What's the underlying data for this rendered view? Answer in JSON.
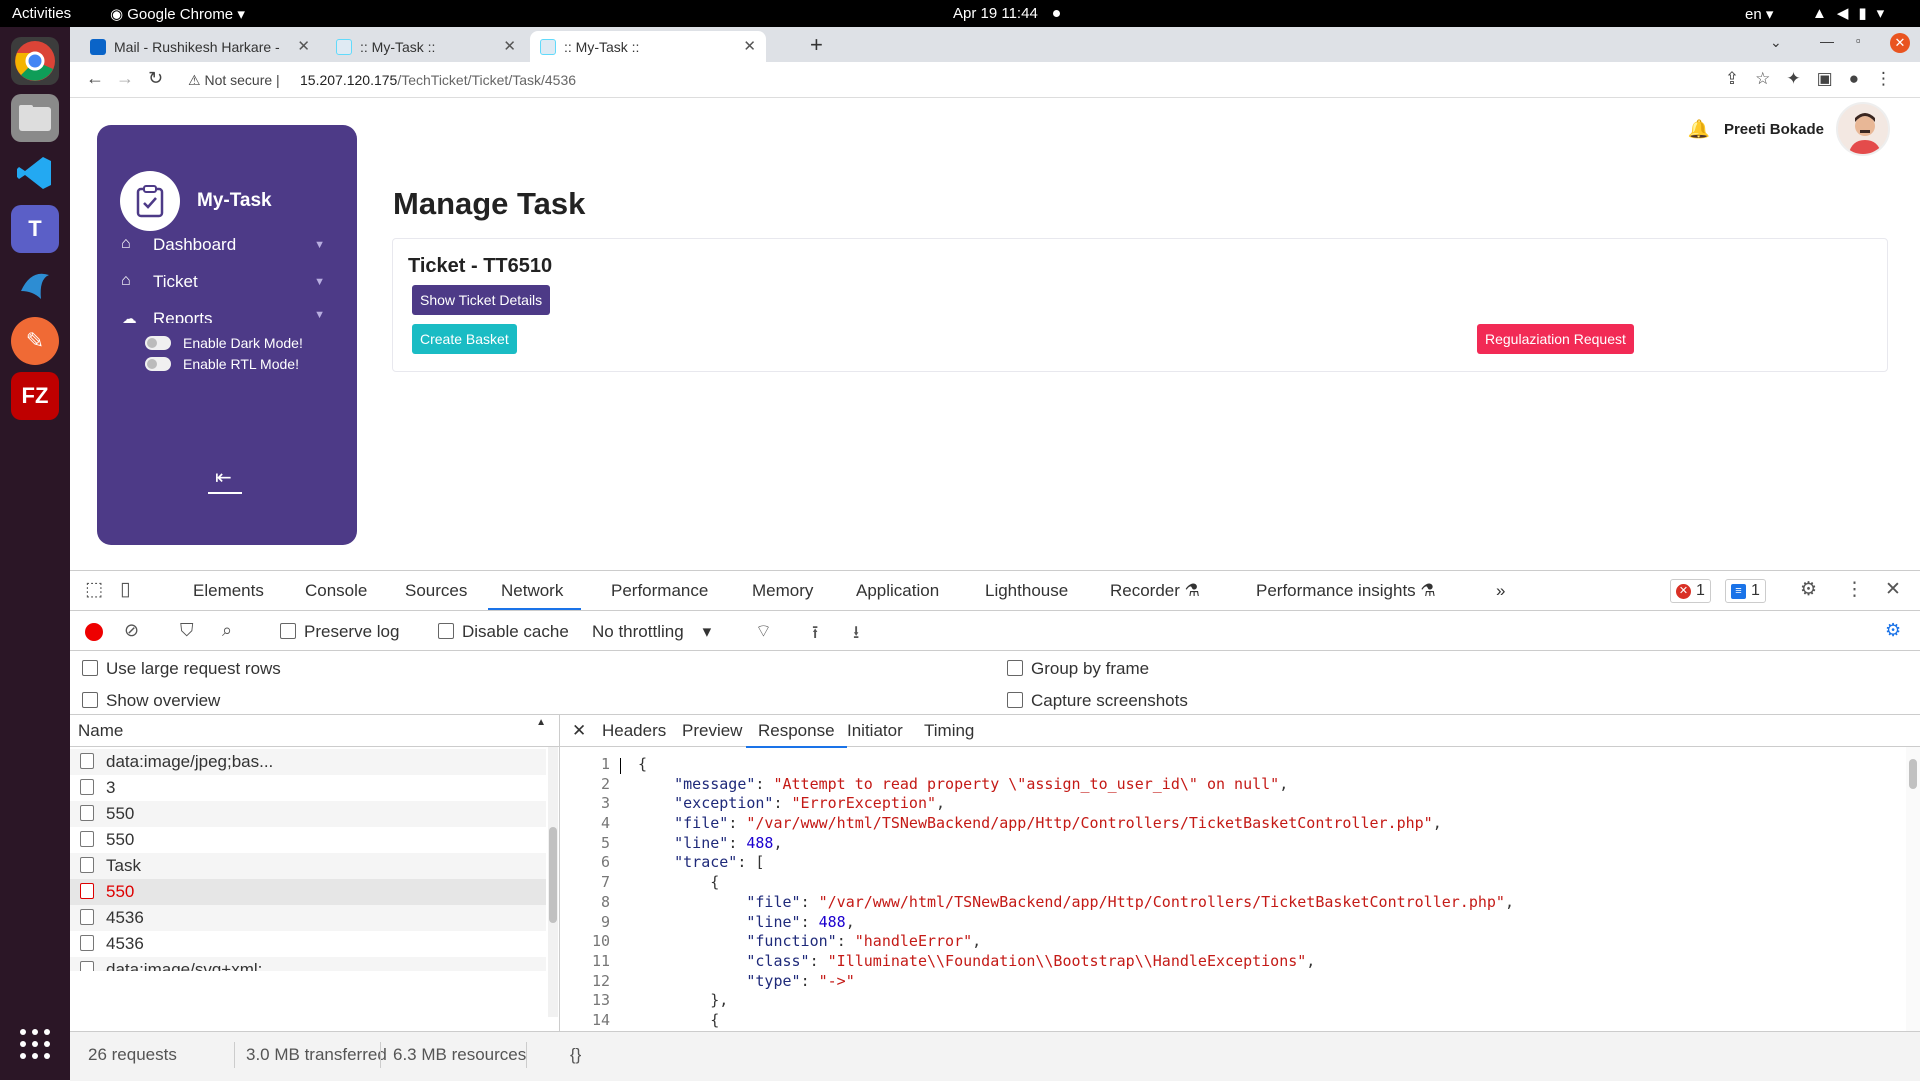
{
  "os": {
    "activities": "Activities",
    "app_name": "Google Chrome",
    "clock": "Apr 19  11:44",
    "lang": "en"
  },
  "browser": {
    "tabs": [
      {
        "label": "Mail - Rushikesh Harkare -",
        "icon": "outlook-icon"
      },
      {
        "label": ":: My-Task ::",
        "icon": "react-icon"
      },
      {
        "label": ":: My-Task ::",
        "icon": "react-icon"
      }
    ],
    "not_secure": "Not secure",
    "url_host": "15.207.120.175",
    "url_path": "/TechTicket/Ticket/Task/4536"
  },
  "app": {
    "brand": "My-Task",
    "menu": [
      {
        "label": "Dashboard",
        "icon": "home-icon"
      },
      {
        "label": "Ticket",
        "icon": "home-icon"
      },
      {
        "label": "Reports",
        "icon": "cloud-icon"
      }
    ],
    "toggles": [
      "Enable Dark Mode!",
      "Enable RTL Mode!"
    ],
    "user_name": "Preeti Bokade",
    "page_title": "Manage Task",
    "ticket_title": "Ticket - TT6510",
    "show_details_btn": "Show Ticket Details",
    "create_basket_btn": "Create Basket",
    "regularization_btn": "Regulaziation Request"
  },
  "devtools": {
    "tabs": [
      "Elements",
      "Console",
      "Sources",
      "Network",
      "Performance",
      "Memory",
      "Application",
      "Lighthouse",
      "Recorder",
      "Performance insights"
    ],
    "active_tab": "Network",
    "error_count": "1",
    "message_count": "1",
    "preserve_log": "Preserve log",
    "disable_cache": "Disable cache",
    "throttling": "No throttling",
    "options": {
      "large_rows": "Use large request rows",
      "show_overview": "Show overview",
      "group_by_frame": "Group by frame",
      "capture_screenshots": "Capture screenshots"
    },
    "name_header": "Name",
    "requests": [
      {
        "name": "data:image/jpeg;bas...",
        "status": "normal"
      },
      {
        "name": "3",
        "status": "normal"
      },
      {
        "name": "550",
        "status": "normal"
      },
      {
        "name": "550",
        "status": "normal"
      },
      {
        "name": "Task",
        "status": "normal"
      },
      {
        "name": "550",
        "status": "error"
      },
      {
        "name": "4536",
        "status": "normal"
      },
      {
        "name": "4536",
        "status": "normal"
      },
      {
        "name": "data:image/svg+xml;...",
        "status": "normal"
      }
    ],
    "detail_tabs": [
      "Headers",
      "Preview",
      "Response",
      "Initiator",
      "Timing"
    ],
    "active_detail_tab": "Response",
    "response_lines": [
      {
        "n": "1",
        "indent": "",
        "parts": [
          [
            "p",
            "{"
          ]
        ]
      },
      {
        "n": "2",
        "indent": "    ",
        "parts": [
          [
            "k",
            "\"message\""
          ],
          [
            "p",
            ": "
          ],
          [
            "s",
            "\"Attempt to read property \\\"assign_to_user_id\\\" on null\""
          ],
          [
            "p",
            ","
          ]
        ]
      },
      {
        "n": "3",
        "indent": "    ",
        "parts": [
          [
            "k",
            "\"exception\""
          ],
          [
            "p",
            ": "
          ],
          [
            "s",
            "\"ErrorException\""
          ],
          [
            "p",
            ","
          ]
        ]
      },
      {
        "n": "4",
        "indent": "    ",
        "parts": [
          [
            "k",
            "\"file\""
          ],
          [
            "p",
            ": "
          ],
          [
            "s",
            "\"/var/www/html/TSNewBackend/app/Http/Controllers/TicketBasketController.php\""
          ],
          [
            "p",
            ","
          ]
        ]
      },
      {
        "n": "5",
        "indent": "    ",
        "parts": [
          [
            "k",
            "\"line\""
          ],
          [
            "p",
            ": "
          ],
          [
            "n",
            "488"
          ],
          [
            "p",
            ","
          ]
        ]
      },
      {
        "n": "6",
        "indent": "    ",
        "parts": [
          [
            "k",
            "\"trace\""
          ],
          [
            "p",
            ": ["
          ]
        ]
      },
      {
        "n": "7",
        "indent": "        ",
        "parts": [
          [
            "p",
            "{"
          ]
        ]
      },
      {
        "n": "8",
        "indent": "            ",
        "parts": [
          [
            "k",
            "\"file\""
          ],
          [
            "p",
            ": "
          ],
          [
            "s",
            "\"/var/www/html/TSNewBackend/app/Http/Controllers/TicketBasketController.php\""
          ],
          [
            "p",
            ","
          ]
        ]
      },
      {
        "n": "9",
        "indent": "            ",
        "parts": [
          [
            "k",
            "\"line\""
          ],
          [
            "p",
            ": "
          ],
          [
            "n",
            "488"
          ],
          [
            "p",
            ","
          ]
        ]
      },
      {
        "n": "10",
        "indent": "            ",
        "parts": [
          [
            "k",
            "\"function\""
          ],
          [
            "p",
            ": "
          ],
          [
            "s",
            "\"handleError\""
          ],
          [
            "p",
            ","
          ]
        ]
      },
      {
        "n": "11",
        "indent": "            ",
        "parts": [
          [
            "k",
            "\"class\""
          ],
          [
            "p",
            ": "
          ],
          [
            "s",
            "\"Illuminate\\\\Foundation\\\\Bootstrap\\\\HandleExceptions\""
          ],
          [
            "p",
            ","
          ]
        ]
      },
      {
        "n": "12",
        "indent": "            ",
        "parts": [
          [
            "k",
            "\"type\""
          ],
          [
            "p",
            ": "
          ],
          [
            "s",
            "\"->\""
          ]
        ]
      },
      {
        "n": "13",
        "indent": "        ",
        "parts": [
          [
            "p",
            "},"
          ]
        ]
      },
      {
        "n": "14",
        "indent": "        ",
        "parts": [
          [
            "p",
            "{"
          ]
        ]
      }
    ],
    "status": {
      "requests": "26 requests",
      "transferred": "3.0 MB transferred",
      "resources": "6.3 MB resources"
    },
    "pretty_print": "{}"
  }
}
